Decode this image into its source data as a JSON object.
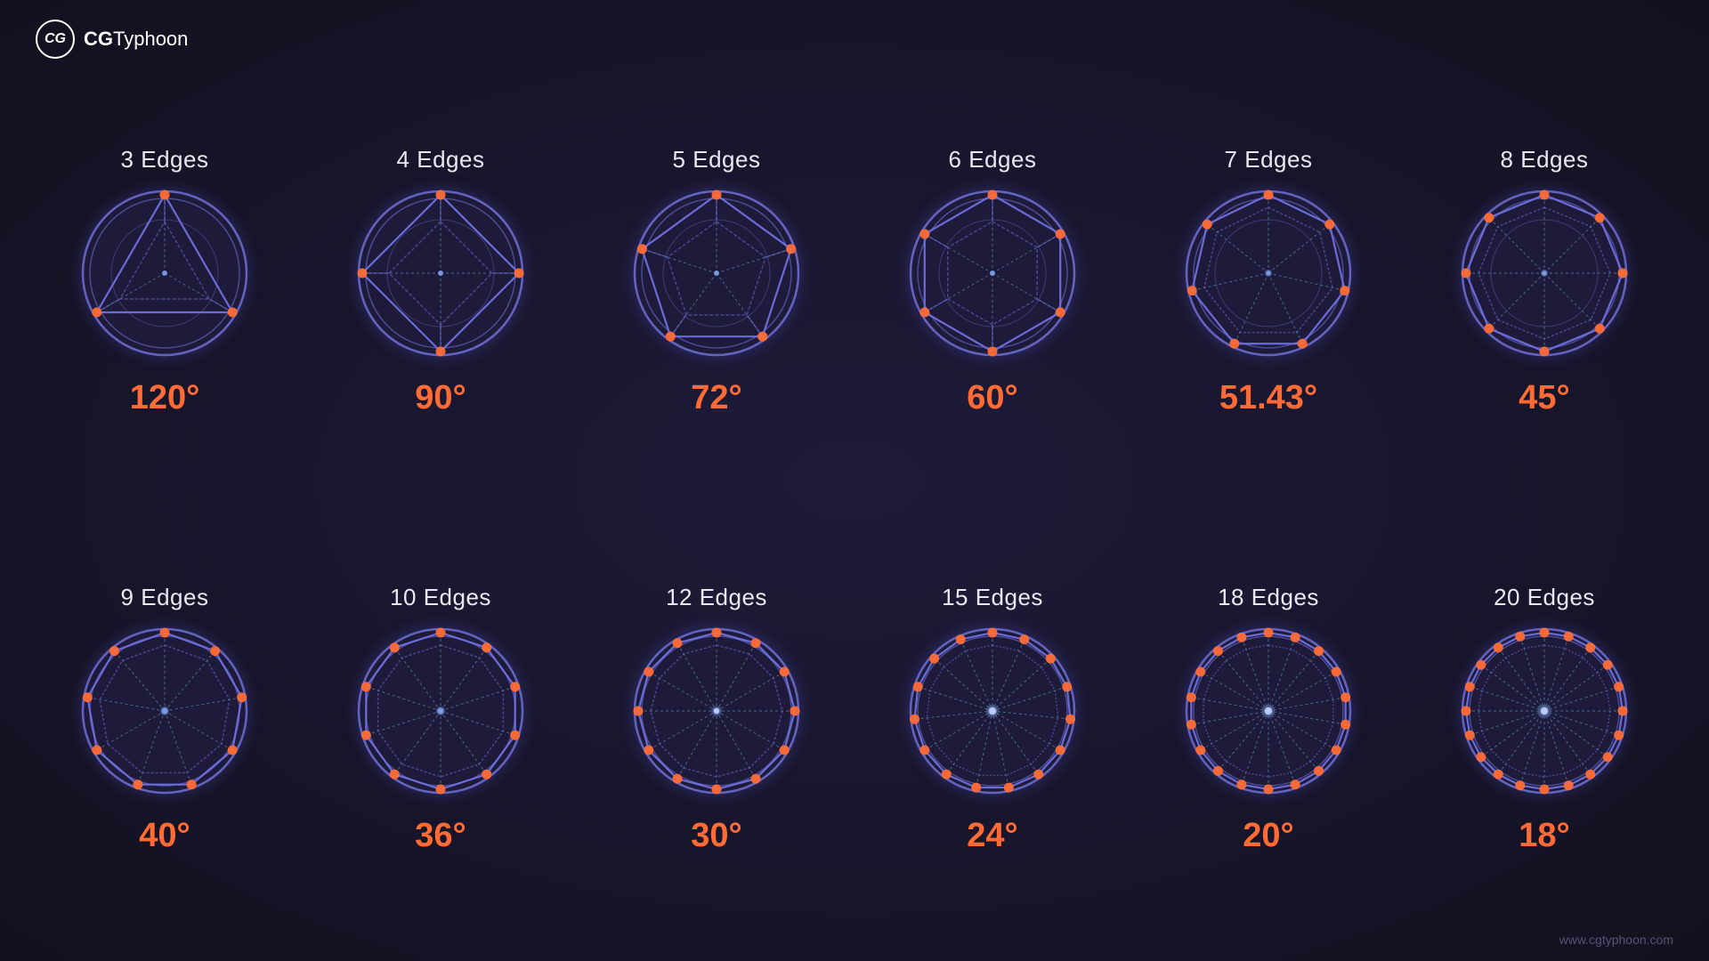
{
  "logo": {
    "icon": "CG",
    "brand": "CG",
    "name": "Typhoon",
    "full": "CGTyphoon"
  },
  "watermark": "www.cgtyphoon.com",
  "polygons": [
    {
      "edges": 3,
      "label": "3 Edges",
      "angle": "120°"
    },
    {
      "edges": 4,
      "label": "4 Edges",
      "angle": "90°"
    },
    {
      "edges": 5,
      "label": "5 Edges",
      "angle": "72°"
    },
    {
      "edges": 6,
      "label": "6 Edges",
      "angle": "60°"
    },
    {
      "edges": 7,
      "label": "7 Edges",
      "angle": "51.43°"
    },
    {
      "edges": 8,
      "label": "8 Edges",
      "angle": "45°"
    },
    {
      "edges": 9,
      "label": "9 Edges",
      "angle": "40°"
    },
    {
      "edges": 10,
      "label": "10 Edges",
      "angle": "36°"
    },
    {
      "edges": 12,
      "label": "12 Edges",
      "angle": "30°"
    },
    {
      "edges": 15,
      "label": "15 Edges",
      "angle": "24°"
    },
    {
      "edges": 18,
      "label": "18 Edges",
      "angle": "20°"
    },
    {
      "edges": 20,
      "label": "20 Edges",
      "angle": "18°"
    }
  ]
}
